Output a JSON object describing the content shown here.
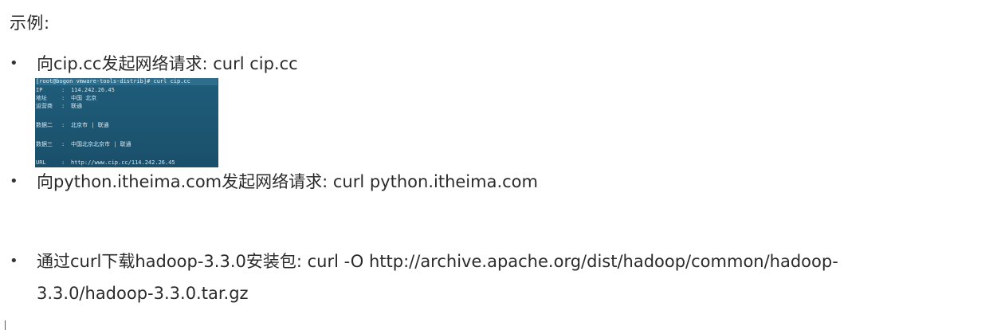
{
  "heading": "示例:",
  "items": [
    {
      "bullet": "•",
      "text": "向cip.cc发起网络请求: curl cip.cc"
    },
    {
      "bullet": "•",
      "text": "向python.itheima.com发起网络请求: curl python.itheima.com"
    },
    {
      "bullet": "•",
      "text_line1": "通过curl下载hadoop-3.3.0安装包: curl -O http://archive.apache.org/dist/hadoop/common/hadoop-",
      "text_line2": "3.3.0/hadoop-3.3.0.tar.gz"
    }
  ],
  "terminal": {
    "prompt": "[root@bogon vmware-tools-distrib]# curl cip.cc",
    "rows": [
      {
        "key": "IP",
        "sep": ":",
        "value": "114.242.26.45"
      },
      {
        "key": "地址",
        "sep": ":",
        "value": "中国  北京"
      },
      {
        "key": "运营商",
        "sep": ":",
        "value": "联通"
      },
      {
        "key": "数据二",
        "sep": ":",
        "value": "北京市 | 联通"
      },
      {
        "key": "数据三",
        "sep": ":",
        "value": "中国北京北京市 | 联通"
      },
      {
        "key": "URL",
        "sep": ":",
        "value": "http://www.cip.cc/114.242.26.45"
      }
    ],
    "colors": {
      "background": "#1f5d7b",
      "text": "#d7e6ee"
    }
  }
}
